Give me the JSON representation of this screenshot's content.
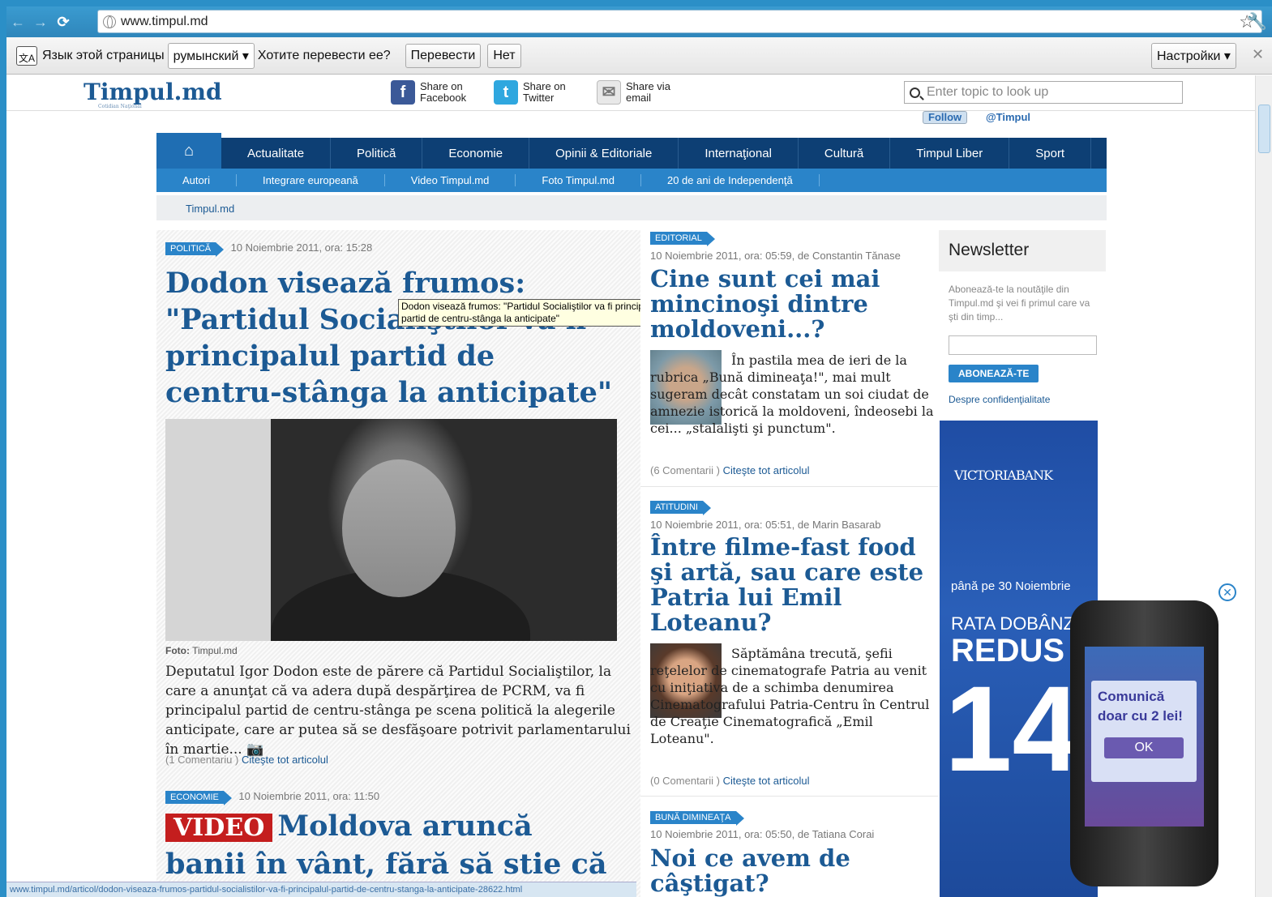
{
  "browser": {
    "url": "www.timpul.md",
    "translate": {
      "prompt1": "Язык этой страницы",
      "language": "румынский ▾",
      "prompt2": "Хотите перевести ее?",
      "translate_btn": "Перевести",
      "no_btn": "Нет",
      "settings": "Настройки ▾"
    },
    "status_url": "www.timpul.md/articol/dodon-viseaza-frumos-partidul-socialistilor-va-fi-principalul-partid-de-centru-stanga-la-anticipate-28622.html"
  },
  "header": {
    "logo": "Timpul.md",
    "logo_sub": "Cotidian Naţional",
    "share_facebook": [
      "Share on",
      "Facebook"
    ],
    "share_twitter": [
      "Share on",
      "Twitter"
    ],
    "share_email": [
      "Share via",
      "email"
    ],
    "search_placeholder": "Enter topic to look up",
    "follow": "Follow",
    "follow_handle": "@Timpul"
  },
  "nav": {
    "main": [
      "Actualitate",
      "Politică",
      "Economie",
      "Opinii & Editoriale",
      "Internaţional",
      "Cultură",
      "Timpul Liber",
      "Sport"
    ],
    "sub": [
      "Autori",
      "Integrare europeană",
      "Video Timpul.md",
      "Foto Timpul.md",
      "20 de ani de Independenţă"
    ],
    "breadcrumb": "Timpul.md"
  },
  "lead": {
    "tag": "POLITICĂ",
    "date": "10 Noiembrie 2011, ora: 15:28",
    "title": "Dodon visează frumos: \"Partidul Socialiştilor va fi principalul partid de centru-stânga la anticipate\"",
    "caption_label": "Foto:",
    "caption": "Timpul.md",
    "body": "Deputatul Igor Dodon este de părere că Partidul Socialiştilor, la care a anunţat că va adera după despărţirea de PCRM, va fi principalul partid de centru-stânga pe scena politică la alegerile anticipate, care ar putea să se desfăşoare potrivit parlamentarului în martie... 📷",
    "comments": "(1 Comentariu )",
    "readmore": "Citeşte tot articolul",
    "tooltip": "Dodon visează frumos: \"Partidul Socialiştilor va fi principalul partid de centru-stânga la anticipate\""
  },
  "second": {
    "tag": "ECONOMIE",
    "date": "10 Noiembrie 2011, ora: 11:50",
    "video": "VIDEO",
    "title": "Moldova aruncă banii în vânt, fără să stie că poate"
  },
  "middle": [
    {
      "tag": "EDITORIAL",
      "meta": "10 Noiembrie 2011, ora: 05:59, de Constantin Tănase",
      "title": "Cine sunt cei mai mincinoşi dintre moldoveni...?",
      "body": "În pastila mea de ieri de la rubrica „Bună dimineaţa!\", mai mult sugeram decât constatam un soi ciudat de amnezie istorică la moldoveni, îndeosebi la cei... „stalalişti şi punctum\".",
      "comments": "(6 Comentarii )",
      "readmore": "Citeşte tot articolul"
    },
    {
      "tag": "ATITUDINI",
      "meta": "10 Noiembrie 2011, ora: 05:51, de Marin Basarab",
      "title": "Între filme-fast food şi artă, sau care este Patria lui Emil Loteanu?",
      "body": "Săptămâna trecută, şefii reţelelor de cinematografe Patria au venit cu iniţiativa de a schimba denumirea Cinematografului Patria-Centru în Centrul de Creaţie Cinematografică „Emil Loteanu\".",
      "comments": "(0 Comentarii )",
      "readmore": "Citeşte tot articolul"
    },
    {
      "tag": "BUNĂ DIMINEAŢA",
      "meta": "10 Noiembrie 2011, ora: 05:50, de Tatiana Corai",
      "title": "Noi ce avem de câştigat?"
    }
  ],
  "newsletter": {
    "title": "Newsletter",
    "text": "Abonează-te la noutăţile din Timpul.md şi vei fi primul care va şti din timp...",
    "button": "ABONEAZĂ-TE",
    "privacy": "Despre confidenţialitate"
  },
  "ad": {
    "brand": "VICTORIABANK",
    "line1": "până pe 30 Noiembrie",
    "line2": "RATA DOBÂNZ",
    "line3": "REDUS",
    "line4": "14",
    "phone_msg": "Comunică doar cu 2 lei!",
    "phone_ok": "OK"
  }
}
